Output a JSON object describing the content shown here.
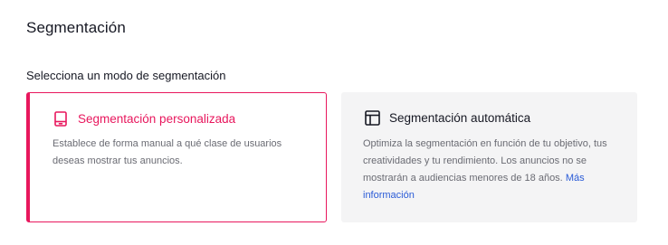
{
  "section": {
    "title": "Segmentación",
    "mode_label": "Selecciona un modo de segmentación"
  },
  "cards": {
    "custom": {
      "icon": "device-tablet-icon",
      "title": "Segmentación personalizada",
      "description": "Establece de forma manual a qué clase de usuarios deseas mostrar tus anuncios.",
      "selected": true
    },
    "auto": {
      "icon": "layout-icon",
      "title": "Segmentación automática",
      "description": "Optimiza la segmentación en función de tu objetivo, tus creatividades y tu rendimiento. Los anuncios no se mostrarán a audiencias menores de 18 años.",
      "link_text": "Más información",
      "selected": false
    }
  },
  "colors": {
    "accent": "#e8175d",
    "link": "#2a5bd7",
    "card_bg_inactive": "#f4f4f5",
    "text_primary": "#161823",
    "text_secondary": "#6a6b73"
  }
}
